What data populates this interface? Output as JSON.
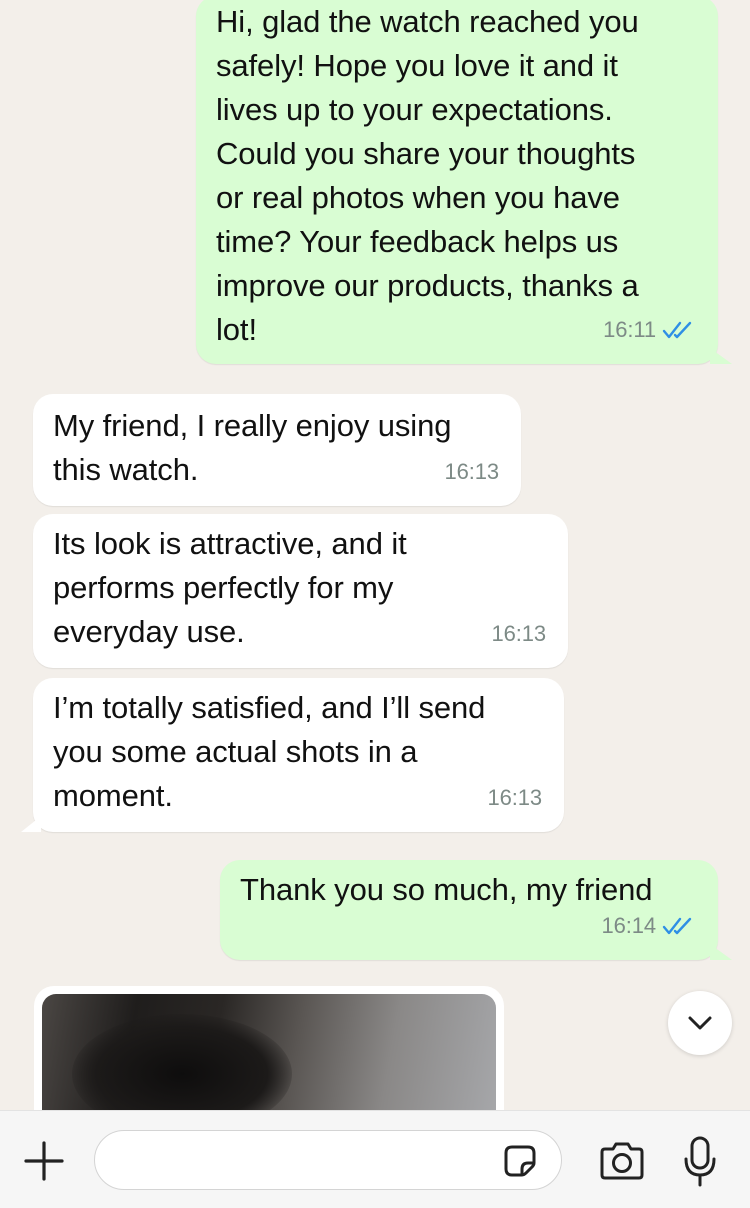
{
  "messages": [
    {
      "direction": "outgoing",
      "text": "Hi, glad the watch reached you\nsafely! Hope you love it and it\nlives up to your expectations.\nCould you share your thoughts\nor real photos when you have\ntime? Your feedback helps us\nimprove our products, thanks a\nlot!",
      "time": "16:11",
      "status": "read"
    },
    {
      "direction": "incoming",
      "text": "My friend, I really enjoy using\nthis watch.",
      "time": "16:13"
    },
    {
      "direction": "incoming",
      "text": "Its look is attractive, and it\nperforms perfectly for my\neveryday use.",
      "time": "16:13"
    },
    {
      "direction": "incoming",
      "text": "I’m totally satisfied, and I’ll send\nyou some actual shots in a\nmoment.",
      "time": "16:13"
    },
    {
      "direction": "outgoing",
      "text": "Thank you so much, my friend",
      "time": "16:14",
      "status": "read"
    }
  ],
  "incoming_photo": {
    "type": "image",
    "visible": "partially"
  },
  "composer": {
    "placeholder": "",
    "icons": [
      "plus-icon",
      "sticker-icon",
      "camera-icon",
      "microphone-icon"
    ]
  },
  "scroll_down_icon": "chevron-down-icon",
  "colors": {
    "background": "#f3efea",
    "outgoing_bubble": "#d9fdd3",
    "incoming_bubble": "#ffffff",
    "read_ticks": "#2f8fe5",
    "timestamp": "#7d8a86"
  }
}
